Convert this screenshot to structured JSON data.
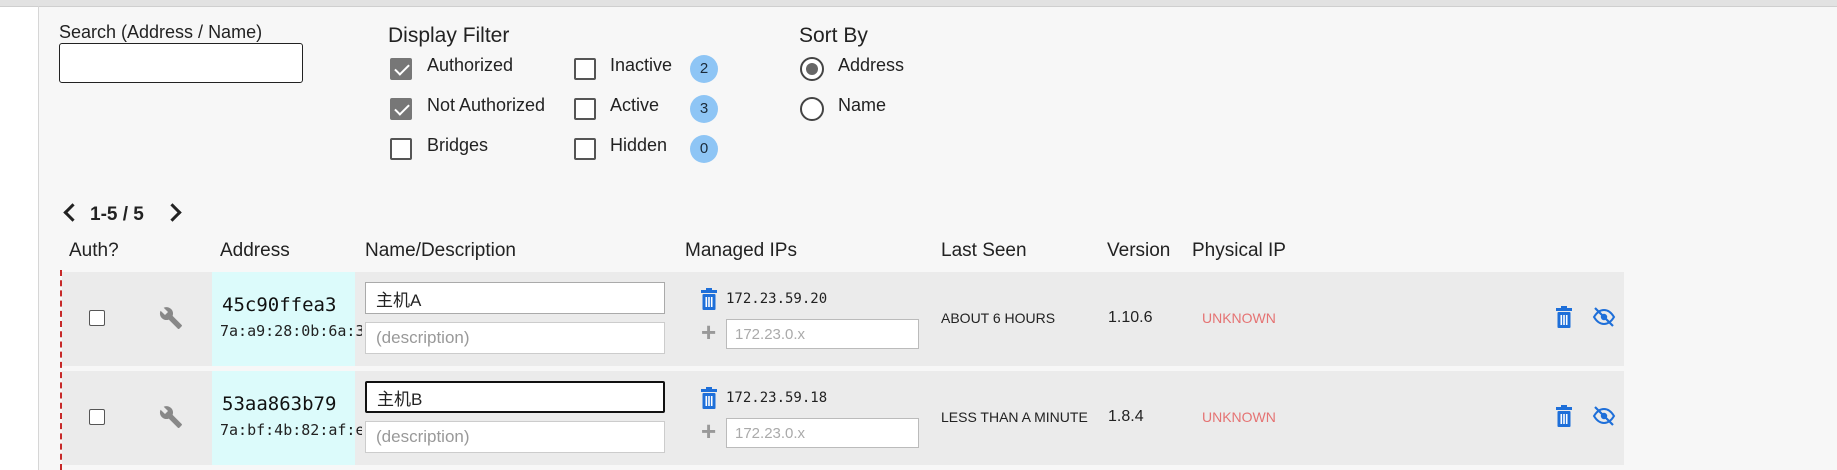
{
  "search": {
    "label": "Search (Address / Name)",
    "value": "",
    "placeholder": ""
  },
  "display_filter": {
    "title": "Display Filter",
    "options": [
      {
        "label": "Authorized",
        "checked": true
      },
      {
        "label": "Not Authorized",
        "checked": true
      },
      {
        "label": "Bridges",
        "checked": false
      },
      {
        "label": "Inactive",
        "checked": false,
        "count": "2"
      },
      {
        "label": "Active",
        "checked": false,
        "count": "3"
      },
      {
        "label": "Hidden",
        "checked": false,
        "count": "0"
      }
    ]
  },
  "sort_by": {
    "title": "Sort By",
    "options": [
      {
        "label": "Address",
        "selected": true
      },
      {
        "label": "Name",
        "selected": false
      }
    ]
  },
  "pagination": {
    "range": "1-5 / 5"
  },
  "columns": {
    "auth": "Auth?",
    "address": "Address",
    "name": "Name/Description",
    "managed_ips": "Managed IPs",
    "last_seen": "Last Seen",
    "version": "Version",
    "physical_ip": "Physical IP"
  },
  "members": [
    {
      "address": "45c90ffea3",
      "mac": "7a:a9:28:0b:6a:3",
      "name": "主机A",
      "description_placeholder": "(description)",
      "ip": "172.23.59.20",
      "ip_placeholder": "172.23.0.x",
      "last_seen": "ABOUT 6 HOURS",
      "version": "1.10.6",
      "physical_ip": "UNKNOWN"
    },
    {
      "address": "53aa863b79",
      "mac": "7a:bf:4b:82:af:e",
      "name": "主机B",
      "description_placeholder": "(description)",
      "ip": "172.23.59.18",
      "ip_placeholder": "172.23.0.x",
      "last_seen": "LESS THAN A MINUTE",
      "version": "1.8.4",
      "physical_ip": "UNKNOWN"
    }
  ],
  "colors": {
    "accent": "#1e6fd9",
    "badge": "#8ec5f5",
    "address_bg": "#dcfbfb",
    "unknown": "#e57373"
  }
}
